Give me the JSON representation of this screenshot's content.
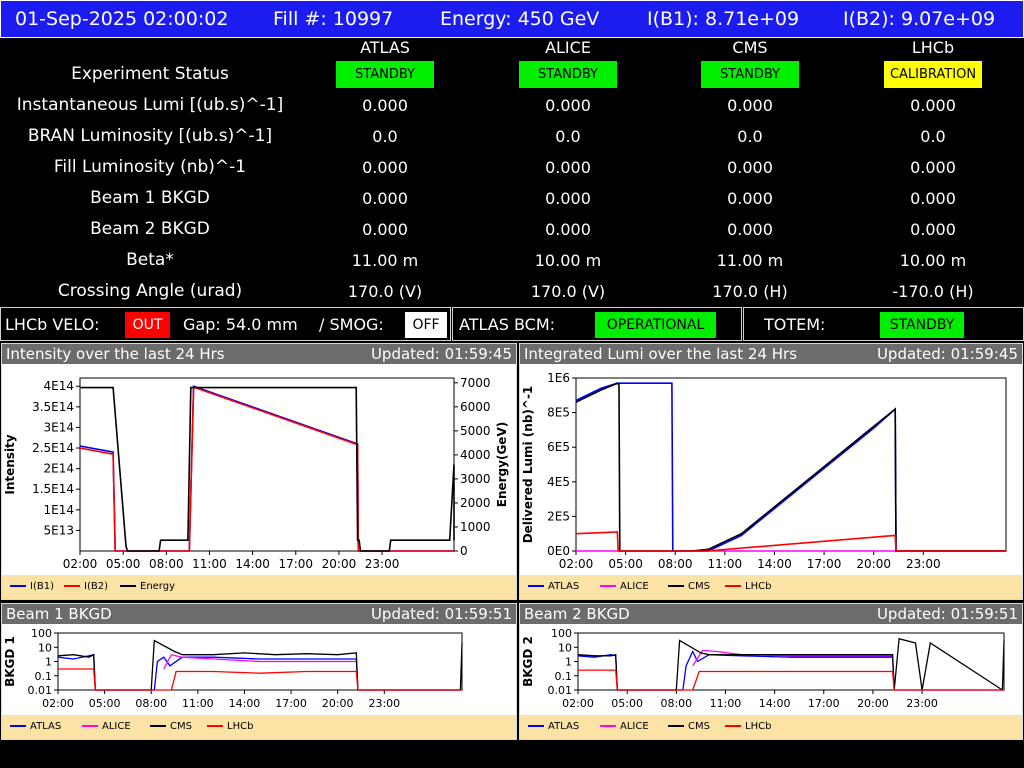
{
  "header": {
    "datetime": "01-Sep-2025 02:00:02",
    "fill": "Fill #: 10997",
    "energy": "Energy: 450 GeV",
    "ib1": "I(B1): 8.71e+09",
    "ib2": "I(B2): 9.07e+09"
  },
  "experiments": [
    "ATLAS",
    "ALICE",
    "CMS",
    "LHCb"
  ],
  "rows": [
    {
      "label": "Experiment Status",
      "values": [
        "STANDBY",
        "STANDBY",
        "STANDBY",
        "CALIBRATION"
      ]
    },
    {
      "label": "Instantaneous Lumi [(ub.s)^-1]",
      "values": [
        "0.000",
        "0.000",
        "0.000",
        "0.000"
      ]
    },
    {
      "label": "BRAN Luminosity [(ub.s)^-1]",
      "values": [
        "0.0",
        "0.0",
        "0.0",
        "0.0"
      ]
    },
    {
      "label": "Fill Luminosity (nb)^-1",
      "values": [
        "0.000",
        "0.000",
        "0.000",
        "0.000"
      ]
    },
    {
      "label": "Beam 1 BKGD",
      "values": [
        "0.000",
        "0.000",
        "0.000",
        "0.000"
      ]
    },
    {
      "label": "Beam 2 BKGD",
      "values": [
        "0.000",
        "0.000",
        "0.000",
        "0.000"
      ]
    },
    {
      "label": "Beta*",
      "values": [
        "11.00 m",
        "10.00 m",
        "11.00 m",
        "10.00 m"
      ]
    },
    {
      "label": "Crossing Angle (urad)",
      "values": [
        "170.0 (V)",
        "170.0 (V)",
        "170.0 (H)",
        "-170.0 (H)"
      ]
    }
  ],
  "status_colors": {
    "STANDBY": "#00ee00",
    "CALIBRATION": "#ffff00",
    "OUT": "#ff0000",
    "OFF": "#ffffff",
    "OPERATIONAL": "#00ee00"
  },
  "strip": {
    "velo_label": "LHCb VELO:",
    "velo_value": "OUT",
    "gap": "Gap: 54.0 mm",
    "smog_label": "/ SMOG:",
    "smog_value": "OFF",
    "bcm_label": "ATLAS BCM:",
    "bcm_value": "OPERATIONAL",
    "totem_label": "TOTEM:",
    "totem_value": "STANDBY"
  },
  "panels": {
    "intensity": {
      "title": "Intensity over the last 24 Hrs",
      "updated": "Updated: 01:59:45"
    },
    "lumi": {
      "title": "Integrated Lumi over the last 24 Hrs",
      "updated": "Updated: 01:59:45"
    },
    "bkgd1": {
      "title": "Beam 1 BKGD",
      "updated": "Updated: 01:59:51"
    },
    "bkgd2": {
      "title": "Beam 2 BKGD",
      "updated": "Updated: 01:59:51"
    }
  },
  "legends": {
    "intensity": [
      "I(B1)",
      "I(B2)",
      "Energy"
    ],
    "experiments": [
      "ATLAS",
      "ALICE",
      "CMS",
      "LHCb"
    ]
  },
  "colors": {
    "ATLAS": "#0000ff",
    "ALICE": "#ff00ff",
    "CMS": "#000000",
    "LHCb": "#ff0000",
    "I(B1)": "#0000ff",
    "I(B2)": "#ff0000",
    "Energy": "#000000"
  },
  "chart_data": [
    {
      "type": "line",
      "title": "Intensity over the last 24 Hrs",
      "ylabel": "Intensity",
      "y2label": "Energy(GeV)",
      "xticks": [
        "02:00",
        "05:00",
        "08:00",
        "11:00",
        "14:00",
        "17:00",
        "20:00",
        "23:00"
      ],
      "yticks": [
        "5E13",
        "1E14",
        "1.5E14",
        "2E14",
        "2.5E14",
        "3E14",
        "3.5E14",
        "4E14"
      ],
      "y2ticks": [
        "0",
        "1000",
        "2000",
        "3000",
        "4000",
        "5000",
        "6000",
        "7000"
      ],
      "xlim": [
        0,
        26
      ],
      "ylim": [
        0,
        420000000000000.0
      ],
      "y2lim": [
        0,
        7200
      ],
      "series": [
        {
          "name": "I(B1)",
          "axis": "y",
          "x": [
            0,
            2.3,
            2.45,
            7.6,
            7.9,
            19.3,
            19.35,
            26
          ],
          "y": [
            255000000000000.0,
            240000000000000.0,
            0,
            0,
            400000000000000.0,
            260000000000000.0,
            0,
            0
          ]
        },
        {
          "name": "I(B2)",
          "axis": "y",
          "x": [
            0,
            2.3,
            2.45,
            7.6,
            7.9,
            19.3,
            19.35,
            26
          ],
          "y": [
            250000000000000.0,
            235000000000000.0,
            0,
            0,
            398000000000000.0,
            258000000000000.0,
            0,
            0
          ]
        },
        {
          "name": "Energy",
          "axis": "y2",
          "x": [
            0,
            2.3,
            3.2,
            3.3,
            5.5,
            5.6,
            7.4,
            7.5,
            7.7,
            7.8,
            19.2,
            19.3,
            19.4,
            19.5,
            21.5,
            21.6,
            25.7,
            26.0,
            26.1,
            26.3,
            26.5,
            26.6,
            26.8,
            27.0
          ],
          "y": [
            6800,
            6800,
            200,
            0,
            0,
            450,
            450,
            450,
            6800,
            6800,
            6800,
            450,
            450,
            0,
            0,
            450,
            450,
            3600,
            450,
            450,
            450,
            450,
            450,
            450
          ]
        }
      ]
    },
    {
      "type": "line",
      "title": "Integrated Lumi over the last 24 Hrs",
      "ylabel": "Delivered Lumi (nb)^-1",
      "xticks": [
        "02:00",
        "05:00",
        "08:00",
        "11:00",
        "14:00",
        "17:00",
        "20:00",
        "23:00"
      ],
      "yticks": [
        "0E0",
        "2E5",
        "4E5",
        "6E5",
        "8E5",
        "1E6"
      ],
      "xlim": [
        0,
        26
      ],
      "ylim": [
        0,
        1000000.0
      ],
      "series": [
        {
          "name": "ATLAS",
          "x": [
            0,
            1.5,
            2.5,
            2.6,
            5.8,
            5.85,
            8.0,
            10.0,
            14.0,
            18.0,
            19.3,
            19.35,
            26
          ],
          "y": [
            870000.0,
            940000.0,
            970000.0,
            970000.0,
            970000.0,
            0,
            0,
            90000.0,
            400000.0,
            710000.0,
            820000.0,
            0,
            0
          ]
        },
        {
          "name": "ALICE",
          "x": [
            0,
            26
          ],
          "y": [
            0,
            0
          ]
        },
        {
          "name": "CMS",
          "x": [
            0,
            1.5,
            2.5,
            2.6,
            2.65,
            7.0,
            8.0,
            10.0,
            14.0,
            18.0,
            19.3,
            19.35,
            26
          ],
          "y": [
            860000.0,
            930000.0,
            970000.0,
            960000.0,
            0,
            0,
            10000.0,
            100000.0,
            410000.0,
            720000.0,
            820000.0,
            0,
            0
          ]
        },
        {
          "name": "LHCb",
          "x": [
            0,
            2.5,
            2.55,
            7.9,
            19.3,
            19.35,
            26
          ],
          "y": [
            100000.0,
            110000.0,
            0,
            0,
            90000.0,
            0,
            0
          ]
        }
      ]
    },
    {
      "type": "line",
      "title": "Beam 1 BKGD",
      "ylabel": "BKGD 1",
      "yscale": "log",
      "xticks": [
        "02:00",
        "05:00",
        "08:00",
        "11:00",
        "14:00",
        "17:00",
        "20:00",
        "23:00"
      ],
      "yticks": [
        "0.01",
        "0.1",
        "1",
        "10",
        "100"
      ],
      "xlim": [
        0,
        26
      ],
      "ylim": [
        0.01,
        100
      ],
      "series": [
        {
          "name": "ATLAS",
          "x": [
            0,
            1,
            2,
            2.3,
            2.4,
            6.2,
            6.4,
            6.8,
            7.2,
            8,
            10,
            13,
            16,
            19.2,
            19.3,
            26
          ],
          "y": [
            2,
            1.5,
            2.5,
            3,
            0.01,
            0.01,
            1,
            2,
            0.5,
            2,
            2,
            1.5,
            1.5,
            1.5,
            0.01,
            0.01
          ]
        },
        {
          "name": "ALICE",
          "x": [
            6.8,
            7.3,
            8,
            10,
            13,
            16,
            19.2
          ],
          "y": [
            0.3,
            3,
            2,
            1.5,
            1,
            1,
            1
          ]
        },
        {
          "name": "CMS",
          "x": [
            0,
            1,
            2,
            2.3,
            2.4,
            6.0,
            6.2,
            7.5,
            8,
            10,
            12,
            14,
            16,
            18,
            19.2,
            19.3,
            25.9,
            26
          ],
          "y": [
            2.5,
            3,
            2,
            3,
            0.01,
            0.01,
            30,
            5,
            3,
            3,
            4,
            3,
            3.5,
            3,
            4,
            0.01,
            0.01,
            20
          ]
        },
        {
          "name": "LHCb",
          "x": [
            0,
            2.3,
            2.4,
            7.3,
            7.6,
            10,
            13,
            16,
            19.2,
            19.3,
            26
          ],
          "y": [
            0.3,
            0.3,
            0.01,
            0.01,
            0.2,
            0.2,
            0.15,
            0.2,
            0.2,
            0.01,
            0.01
          ]
        }
      ]
    },
    {
      "type": "line",
      "title": "Beam 2 BKGD",
      "ylabel": "BKGD 2",
      "yscale": "log",
      "xticks": [
        "02:00",
        "05:00",
        "08:00",
        "11:00",
        "14:00",
        "17:00",
        "20:00",
        "23:00"
      ],
      "yticks": [
        "0.01",
        "0.1",
        "1",
        "10",
        "100"
      ],
      "xlim": [
        0,
        26
      ],
      "ylim": [
        0.01,
        100
      ],
      "series": [
        {
          "name": "ATLAS",
          "x": [
            0,
            1,
            2,
            2.3,
            2.4,
            6.4,
            6.6,
            7.0,
            7.3,
            8,
            10,
            13,
            16,
            19.2,
            19.3,
            26
          ],
          "y": [
            2.5,
            2,
            3,
            2.5,
            0.01,
            0.01,
            0.5,
            5,
            1,
            3,
            2.5,
            2,
            2,
            2,
            0.01,
            0.01
          ]
        },
        {
          "name": "ALICE",
          "x": [
            7.0,
            7.6,
            8.5,
            10,
            13,
            16,
            19.2
          ],
          "y": [
            0.5,
            6,
            5,
            3,
            2.5,
            2.5,
            2.5
          ]
        },
        {
          "name": "CMS",
          "x": [
            0,
            1,
            2,
            2.3,
            2.4,
            6.0,
            6.2,
            7.5,
            8,
            10,
            12,
            14,
            16,
            18,
            19.2,
            19.3,
            19.6,
            20.6,
            21,
            21.5,
            25.9,
            26
          ],
          "y": [
            3,
            2.5,
            2.5,
            3,
            0.01,
            0.01,
            30,
            4,
            3,
            3,
            3,
            3,
            3,
            3,
            3,
            0.01,
            40,
            20,
            0.01,
            20,
            0.01,
            30
          ]
        },
        {
          "name": "LHCb",
          "x": [
            0,
            2.3,
            2.4,
            7.0,
            7.4,
            10,
            13,
            16,
            19.2,
            19.3,
            26
          ],
          "y": [
            0.25,
            0.25,
            0.01,
            0.01,
            0.2,
            0.2,
            0.2,
            0.2,
            0.2,
            0.01,
            0.01
          ]
        }
      ]
    }
  ]
}
